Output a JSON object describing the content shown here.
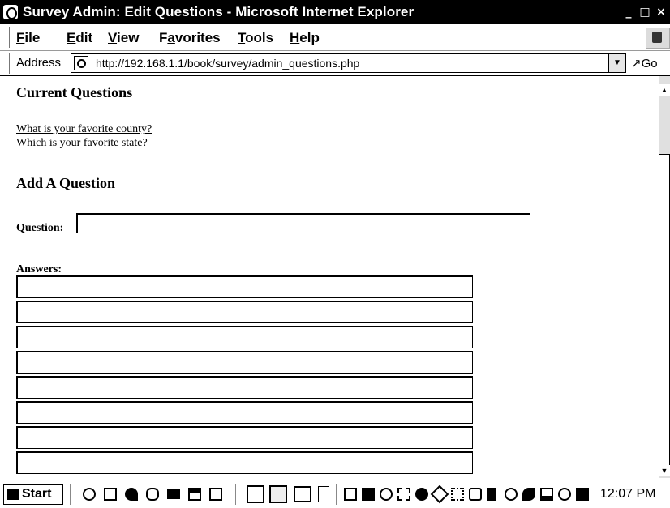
{
  "window": {
    "title": "Survey Admin: Edit Questions - Microsoft Internet Explorer",
    "buttons": [
      "_",
      "Ɖ",
      "×"
    ]
  },
  "menu": [
    {
      "label": "File",
      "key": "F",
      "rest": "ile"
    },
    {
      "label": "Edit",
      "key": "E",
      "rest": "dit"
    },
    {
      "label": "View",
      "key": "V",
      "rest": "iew"
    },
    {
      "label": "Favorites",
      "key": "a",
      "pre": "F",
      "rest": "vorites"
    },
    {
      "label": "Tools",
      "key": "T",
      "rest": "ools"
    },
    {
      "label": "Help",
      "key": "H",
      "rest": "elp"
    }
  ],
  "address": {
    "label": "Address",
    "url": "http://192.168.1.1/book/survey/admin_questions.php",
    "go": "Go"
  },
  "page": {
    "current_heading": "Current Questions",
    "questions": [
      "What is your favorite county?",
      "Which is your favorite state?"
    ],
    "add_heading": "Add A Question",
    "question_label": "Question:",
    "question_value": "",
    "answers_label": "Answers:",
    "answers": [
      "",
      "",
      "",
      "",
      "",
      "",
      "",
      ""
    ]
  },
  "taskbar": {
    "start": "Start",
    "clock": "12:07 PM"
  }
}
